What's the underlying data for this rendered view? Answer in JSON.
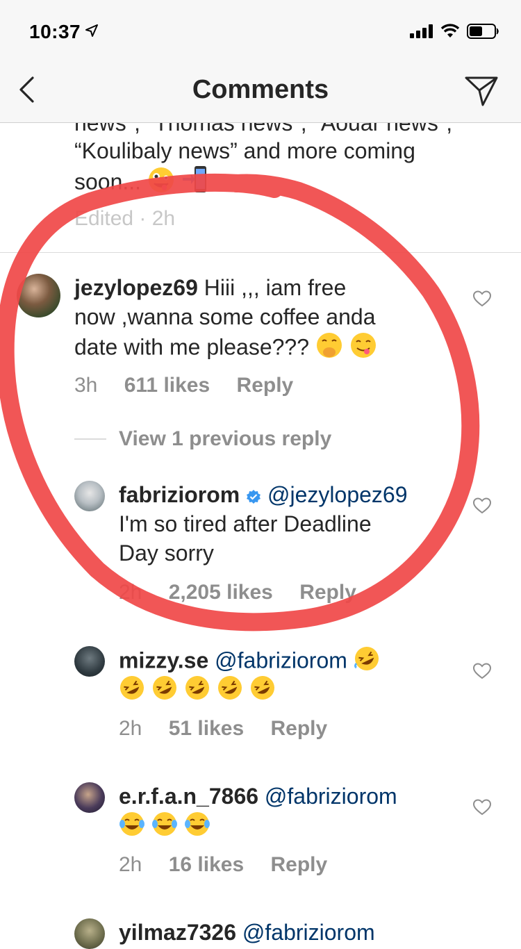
{
  "status_bar": {
    "time": "10:37"
  },
  "nav": {
    "title": "Comments"
  },
  "partial_comment": {
    "line1": "news\",  \"Thomas news\",  \"Aouar news\",",
    "line2": "“Koulibaly news” and more coming",
    "line3": "soon...",
    "edited": "Edited · 2h"
  },
  "comments": [
    {
      "username": "jezylopez69",
      "line1": "Hiii ,,, iam free",
      "line2": "now ,wanna some coffee anda",
      "line3": "date with me please???",
      "time": "3h",
      "likes": "611 likes",
      "reply": "Reply"
    }
  ],
  "view_previous": "View 1 previous reply",
  "replies": [
    {
      "username": "fabriziorom",
      "mention": "@jezylopez69",
      "line1": "I'm so tired after Deadline",
      "line2": "Day sorry",
      "time": "2h",
      "likes": "2,205 likes",
      "reply": "Reply"
    },
    {
      "username": "mizzy.se",
      "mention": "@fabriziorom",
      "time": "2h",
      "likes": "51 likes",
      "reply": "Reply"
    },
    {
      "username": "e.r.f.a.n_7866",
      "mention": "@fabriziorom",
      "time": "2h",
      "likes": "16 likes",
      "reply": "Reply"
    },
    {
      "username": "yilmaz7326",
      "mention": "@fabriziorom"
    }
  ],
  "icons": [
    "back-chevron-icon",
    "send-icon",
    "heart-icon",
    "verified-badge-icon",
    "location-arrow-icon",
    "signal-icon",
    "wifi-icon",
    "battery-icon"
  ],
  "colors": {
    "mention": "#003569",
    "meta": "#8e8e8e",
    "verified": "#3897f0",
    "annotation_ring": "#f04848"
  }
}
